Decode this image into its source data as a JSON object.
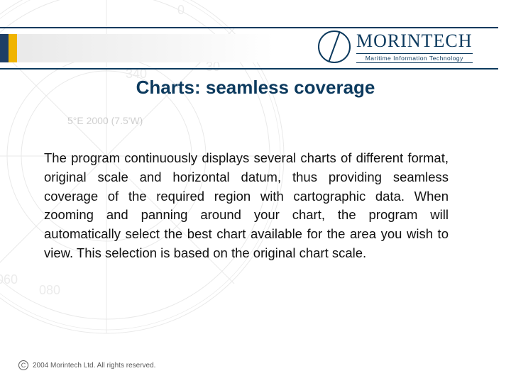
{
  "brand": {
    "name": "MORINTECH",
    "tagline": "Maritime Information Technology"
  },
  "bg_label": "5°E 2000 (7.5'W)",
  "title": "Charts: seamless coverage",
  "body": "The program continuously displays several charts of different format, original scale and horizontal datum, thus providing seamless coverage of the required region with cartographic data. When zooming and panning around your chart, the program will automatically select the best chart available for the area you wish to view. This selection is based on the original chart scale.",
  "footer": {
    "copyright_symbol": "C",
    "text": "2004 Morintech Ltd. All rights reserved."
  }
}
